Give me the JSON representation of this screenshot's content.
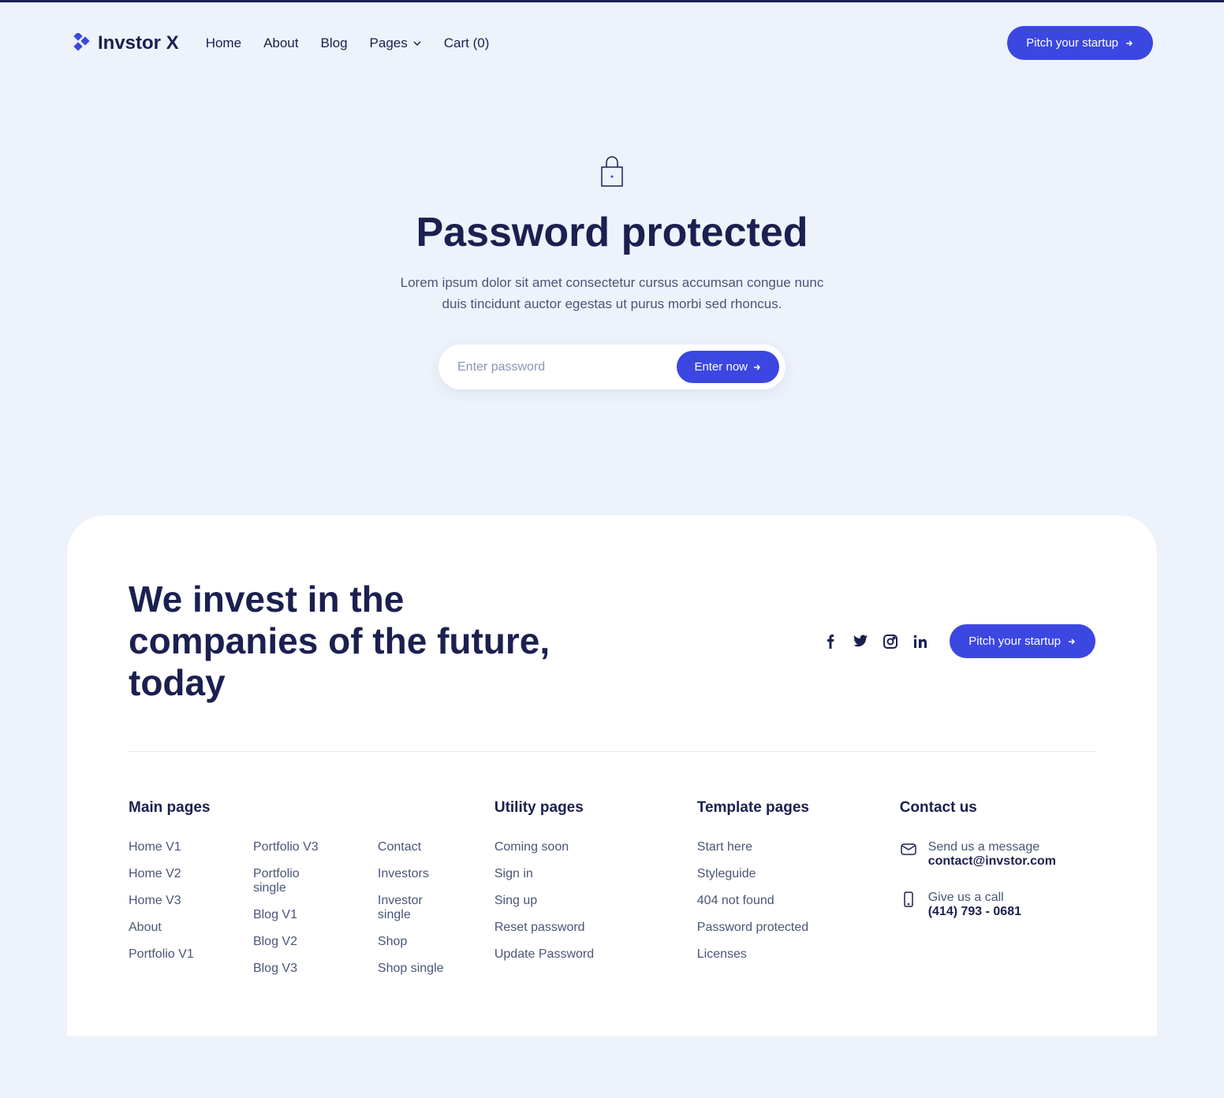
{
  "brand": "Invstor X",
  "nav": {
    "items": [
      {
        "label": "Home"
      },
      {
        "label": "About"
      },
      {
        "label": "Blog"
      },
      {
        "label": "Pages"
      }
    ],
    "cart_label": "Cart (0)"
  },
  "cta_button": "Pitch your startup",
  "hero": {
    "title": "Password protected",
    "desc": "Lorem ipsum dolor sit amet consectetur cursus accumsan congue nunc duis tincidunt auctor egestas ut purus morbi sed rhoncus.",
    "placeholder": "Enter password",
    "button": "Enter now"
  },
  "footer": {
    "heading": "We invest in the companies of the future, today",
    "cta": "Pitch your startup",
    "cols": {
      "main": {
        "title": "Main pages",
        "c1": [
          "Home V1",
          "Home V2",
          "Home V3",
          "About",
          "Portfolio V1"
        ],
        "c2": [
          "Portfolio V3",
          "Portfolio single",
          "Blog V1",
          "Blog V2",
          "Blog V3"
        ],
        "c3": [
          "Contact",
          "Investors",
          "Investor single",
          "Shop",
          "Shop single"
        ]
      },
      "util": {
        "title": "Utility pages",
        "items": [
          "Coming soon",
          "Sign in",
          "Sing up",
          "Reset password",
          "Update Password"
        ]
      },
      "tmpl": {
        "title": "Template pages",
        "items": [
          "Start here",
          "Styleguide",
          "404 not found",
          "Password protected",
          "Licenses"
        ]
      },
      "contact": {
        "title": "Contact us",
        "email_label": "Send us a message",
        "email": "contact@invstor.com",
        "phone_label": "Give us a call",
        "phone": "(414) 793 - 0681"
      }
    }
  }
}
